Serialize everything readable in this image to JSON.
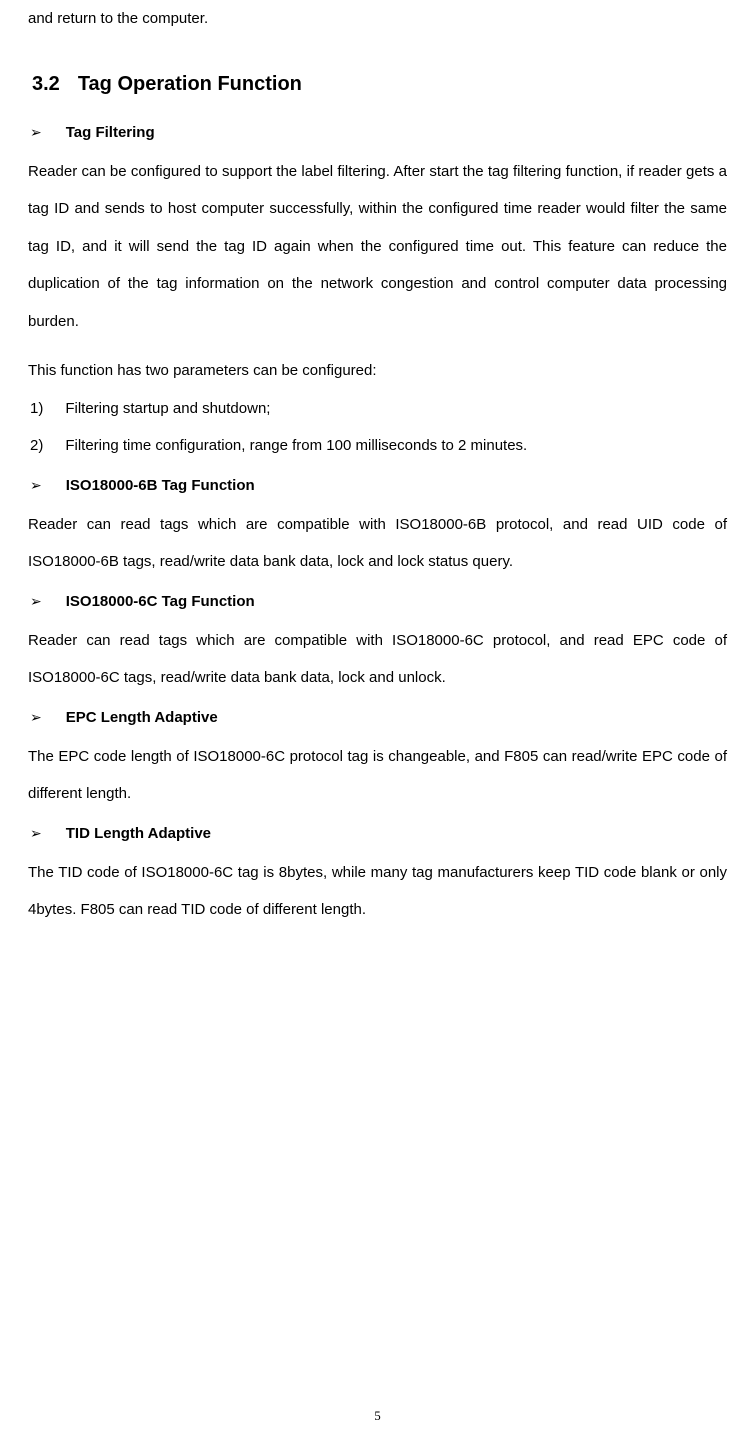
{
  "continuation": "and return to the computer.",
  "section": {
    "number": "3.2",
    "title": "Tag Operation Function"
  },
  "subsections": [
    {
      "title": "Tag Filtering",
      "paragraphs": [
        "Reader can be configured to support the label filtering. After start the tag filtering function, if reader gets a tag ID and sends to host computer successfully, within the configured time reader would filter the same tag ID, and it will send the tag ID again when the configured time out. This feature can reduce the duplication of the tag information on the network congestion and control computer data processing burden.",
        "This function has two parameters can be configured:"
      ],
      "listItems": [
        {
          "number": "1)",
          "text": "Filtering startup and shutdown;"
        },
        {
          "number": "2)",
          "text": "Filtering time configuration, range from 100 milliseconds to 2 minutes."
        }
      ]
    },
    {
      "title": "ISO18000-6B Tag Function",
      "paragraphs": [
        "Reader can read tags which are compatible with ISO18000-6B protocol, and read UID code of ISO18000-6B tags, read/write data bank data, lock and lock status query."
      ]
    },
    {
      "title": "ISO18000-6C Tag Function",
      "paragraphs": [
        "Reader can read tags which are compatible with ISO18000-6C protocol, and read EPC code of ISO18000-6C tags, read/write data bank data, lock and unlock."
      ]
    },
    {
      "title": "EPC Length Adaptive",
      "paragraphs": [
        "The EPC code length of ISO18000-6C protocol tag is changeable, and F805 can read/write EPC code of different length."
      ]
    },
    {
      "title": "TID Length Adaptive",
      "paragraphs": [
        "The TID code of ISO18000-6C tag is 8bytes, while many tag manufacturers keep TID code blank or only 4bytes. F805 can read TID code of different length."
      ]
    }
  ],
  "arrowGlyph": "➢",
  "pageNumber": "5"
}
